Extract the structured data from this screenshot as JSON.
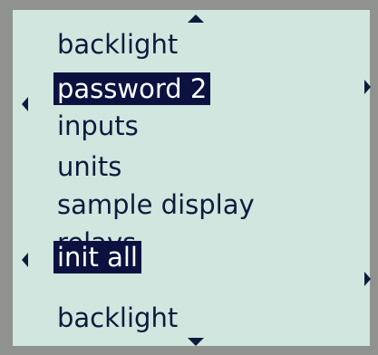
{
  "menu": {
    "items": [
      {
        "label": "backlight",
        "selected": false
      },
      {
        "label": "password 2",
        "selected": true
      },
      {
        "label": "inputs",
        "selected": false
      },
      {
        "label": "units",
        "selected": false
      },
      {
        "label": "sample display",
        "selected": false
      },
      {
        "label": "relays",
        "selected": false
      },
      {
        "label": "init all",
        "selected": true
      },
      {
        "label": "backlight",
        "selected": false
      }
    ]
  },
  "colors": {
    "background": "#d1e6df",
    "bezel": "#8f928f",
    "text": "#0e1a3c",
    "highlight": "#0b1240",
    "highlight_text": "#ffffff"
  },
  "icons": [
    "scroll-up-arrow-icon",
    "scroll-down-arrow-icon",
    "left-arrow-icon",
    "right-arrow-icon"
  ]
}
